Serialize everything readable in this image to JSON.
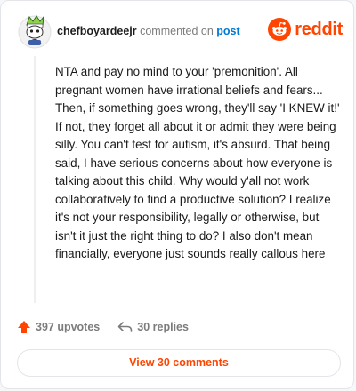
{
  "header": {
    "username": "chefboyardeejr",
    "commented_text": "commented on",
    "post_link": "post",
    "brand": "reddit"
  },
  "comment": {
    "body": "NTA and pay no mind to your 'premonition'. All pregnant women have irrational beliefs and fears... Then, if something goes wrong, they'll say 'I KNEW it!' If not, they forget all about it or admit they were being silly. You can't test for autism, it's absurd. That being said, I have serious concerns about how everyone is talking about this child. Why would y'all not work collaboratively to find a productive solution? I realize it's not your responsibility, legally or otherwise, but isn't it just the right thing to do? I also don't mean financially, everyone just sounds really callous here"
  },
  "actions": {
    "upvotes": "397 upvotes",
    "replies": "30 replies"
  },
  "footer": {
    "view_comments": "View 30 comments"
  },
  "colors": {
    "brand": "#ff4500",
    "link": "#0079d3",
    "muted": "#7c7c7c"
  },
  "icons": {
    "avatar": "snoo-avatar-icon",
    "logo": "reddit-logo-icon",
    "upvote": "upvote-arrow-icon",
    "reply": "reply-arrow-icon"
  }
}
